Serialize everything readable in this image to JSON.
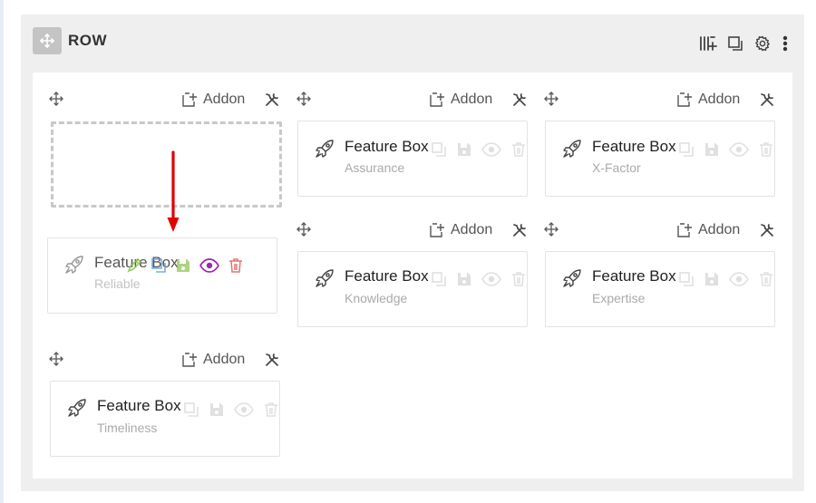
{
  "row": {
    "title": "ROW"
  },
  "addon_label": "Addon",
  "cards": [
    {
      "title": "Feature Box",
      "subtitle": "Assurance"
    },
    {
      "title": "Feature Box",
      "subtitle": "X-Factor"
    },
    {
      "title": "Feature Box",
      "subtitle": "Reliable"
    },
    {
      "title": "Feature Box",
      "subtitle": "Knowledge"
    },
    {
      "title": "Feature Box",
      "subtitle": "Expertise"
    },
    {
      "title": "Feature Box",
      "subtitle": "Timeliness"
    }
  ],
  "icons": {
    "row_handle": "move-icon",
    "columns": "columns-add-icon",
    "duplicate": "copy-icon",
    "settings": "gear-icon",
    "more": "more-vertical-icon",
    "addon": "add-addon-icon",
    "column_settings": "tools-icon",
    "card": "rocket-icon",
    "edit": "pencil-icon",
    "copy": "copy-icon",
    "save": "save-icon",
    "visibility": "eye-icon",
    "delete": "trash-icon"
  },
  "colors": {
    "edit": "#8bc34a",
    "copy": "#5b9bd5",
    "save": "#8bc34a",
    "visibility": "#9c27b0",
    "delete": "#e57373",
    "arrow": "#e00000"
  }
}
